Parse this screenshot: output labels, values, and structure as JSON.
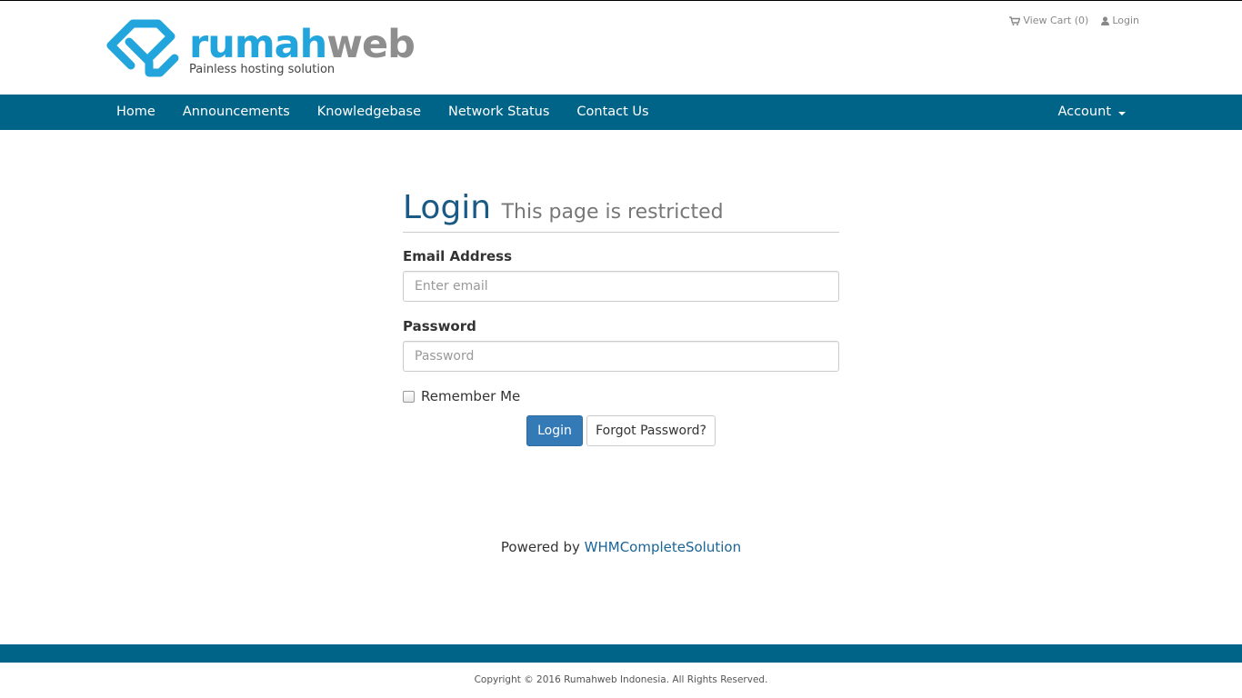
{
  "brand": {
    "name_part1": "rumah",
    "name_part2": "web",
    "tagline": "Painless hosting solution",
    "colors": {
      "primary": "#22a5dc",
      "secondary": "#8e8e8e",
      "nav": "#006489"
    }
  },
  "toplinks": {
    "cart_label": "View Cart (0)",
    "cart_icon": "cart-icon",
    "login_label": "Login",
    "login_icon": "user-icon"
  },
  "nav": {
    "items": [
      {
        "label": "Home"
      },
      {
        "label": "Announcements"
      },
      {
        "label": "Knowledgebase"
      },
      {
        "label": "Network Status"
      },
      {
        "label": "Contact Us"
      }
    ],
    "account_label": "Account"
  },
  "login": {
    "title": "Login",
    "subtitle": "This page is restricted",
    "email_label": "Email Address",
    "email_placeholder": "Enter email",
    "email_value": "",
    "password_label": "Password",
    "password_placeholder": "Password",
    "password_value": "",
    "remember_label": "Remember Me",
    "remember_checked": false,
    "login_button": "Login",
    "forgot_button": "Forgot Password?"
  },
  "powered": {
    "prefix": "Powered by",
    "link": "WHMCompleteSolution"
  },
  "footer": {
    "copyright": "Copyright © 2016 Rumahweb Indonesia. All Rights Reserved."
  }
}
